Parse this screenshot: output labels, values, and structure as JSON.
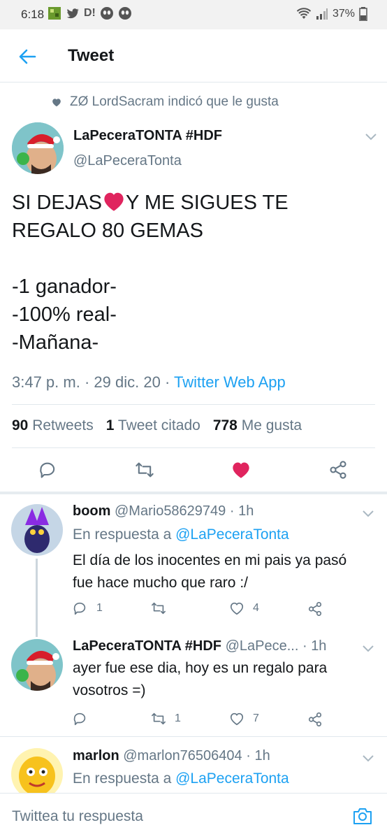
{
  "status_bar": {
    "time": "6:18",
    "battery": "37%",
    "notification_icons": [
      "game-icon",
      "twitter-bird-icon",
      "d-icon",
      "alien-icon",
      "alien-icon"
    ]
  },
  "header": {
    "title": "Tweet"
  },
  "social_context": {
    "text": "ZØ LordSacram indicó que le gusta"
  },
  "tweet": {
    "author_name": "LaPeceraTONTA #HDF",
    "author_handle": "@LaPeceraTonta",
    "text_lines": [
      "SI DEJAS",
      "Y ME SIGUES TE",
      "REGALO 80 GEMAS",
      "-1 ganador-",
      "-100% real-",
      "-Mañana-"
    ],
    "time": "3:47 p. m.",
    "date": "29 dic. 20",
    "source": "Twitter Web App",
    "retweets_count": "90",
    "retweets_label": "Retweets",
    "quotes_count": "1",
    "quotes_label": "Tweet citado",
    "likes_count": "778",
    "likes_label": "Me gusta",
    "liked": true,
    "like_color": "#e0245e"
  },
  "replies": [
    {
      "name": "boom",
      "handle": "@Mario58629749",
      "time": "1h",
      "reply_to_prefix": "En respuesta a",
      "reply_to": "@LaPeceraTonta",
      "text_lines": [
        "El día de los inocentes en mi pais ya pasó",
        "fue hace mucho que raro :/"
      ],
      "reply_count": "1",
      "retweet_count": "",
      "like_count": "4"
    },
    {
      "name": "LaPeceraTONTA #HDF",
      "handle": "@LaPece...",
      "time": "1h",
      "text_lines": [
        "ayer fue ese dia, hoy es un regalo para",
        "vosotros =)"
      ],
      "reply_count": "",
      "retweet_count": "1",
      "like_count": "7"
    },
    {
      "name": "marlon",
      "handle": "@marlon76506404",
      "time": "1h",
      "reply_to_prefix": "En respuesta a",
      "reply_to": "@LaPeceraTonta"
    }
  ],
  "compose": {
    "placeholder": "Twittea tu respuesta"
  },
  "colors": {
    "accent": "#1da1f2",
    "secondary_text": "#657786",
    "like": "#e0245e"
  }
}
